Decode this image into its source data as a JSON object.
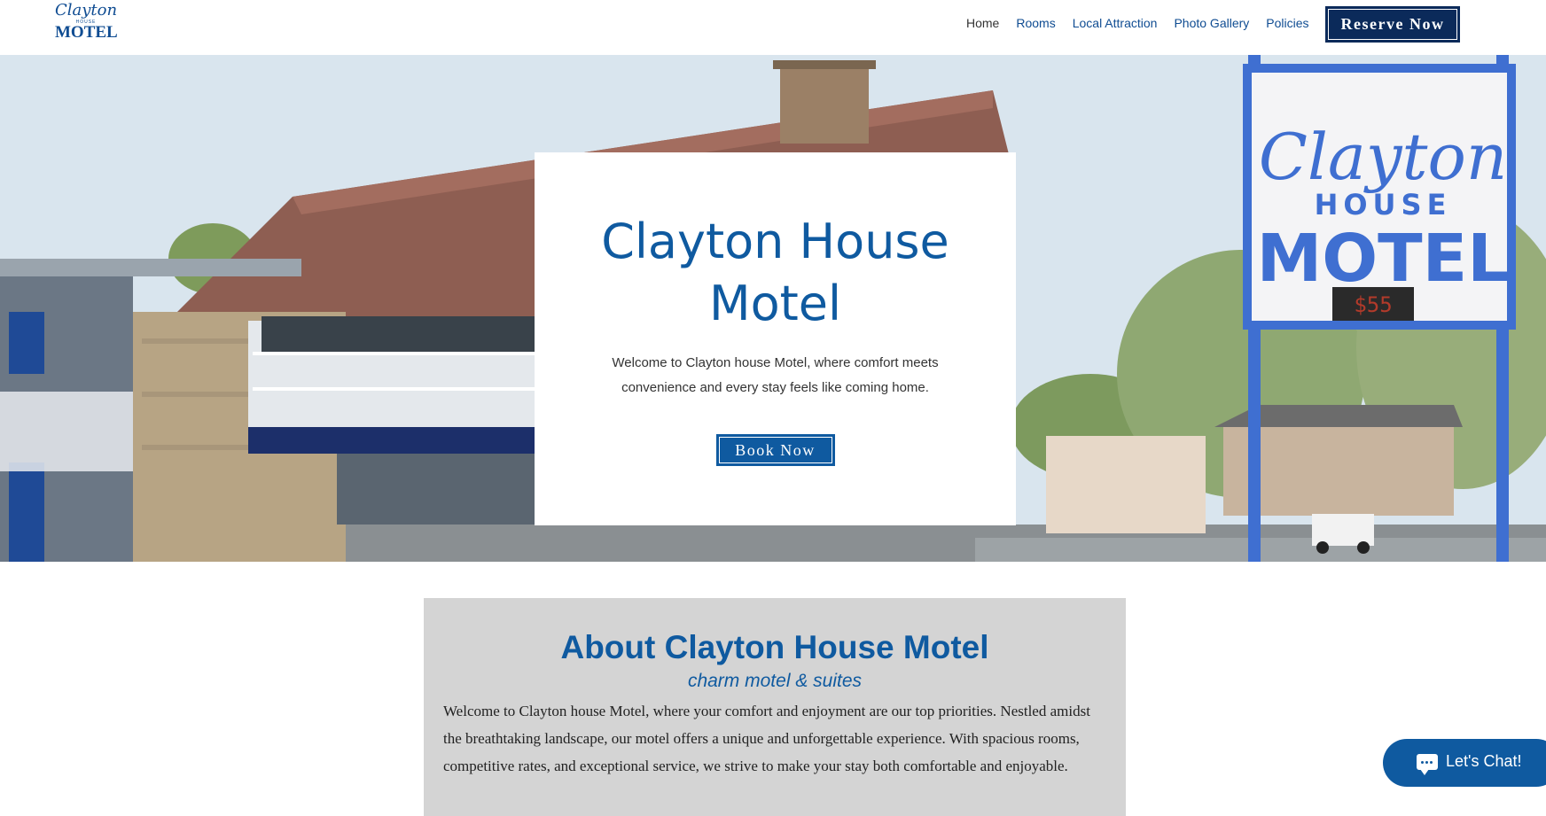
{
  "header": {
    "logo": {
      "script": "Clayton",
      "small": "HOUSE",
      "big": "MOTEL"
    },
    "nav": [
      "Home",
      "Rooms",
      "Local Attraction",
      "Photo Gallery",
      "Policies"
    ],
    "reserve_label": "Reserve Now"
  },
  "hero": {
    "title_line1": "Clayton House",
    "title_line2": "Motel",
    "subtitle_line1": "Welcome to Clayton house Motel, where comfort meets",
    "subtitle_line2": "convenience and every stay feels like coming home.",
    "book_label": "Book Now",
    "sign": {
      "line1": "Clayton",
      "line2": "HOUSE",
      "line3": "MOTEL",
      "price": "$55"
    }
  },
  "about": {
    "title": "About Clayton House Motel",
    "tagline": "charm motel & suites",
    "body": "Welcome to Clayton house Motel, where your comfort and enjoyment are our top priorities. Nestled amidst the breathtaking landscape, our motel offers a unique and unforgettable experience. With spacious rooms, competitive rates, and exceptional service, we strive to make your stay both comfortable and enjoyable."
  },
  "chat": {
    "label": "Let's Chat!"
  },
  "colors": {
    "brand_blue": "#0f5aa0",
    "navy": "#0b2a5a",
    "about_bg": "#d4d4d4"
  }
}
